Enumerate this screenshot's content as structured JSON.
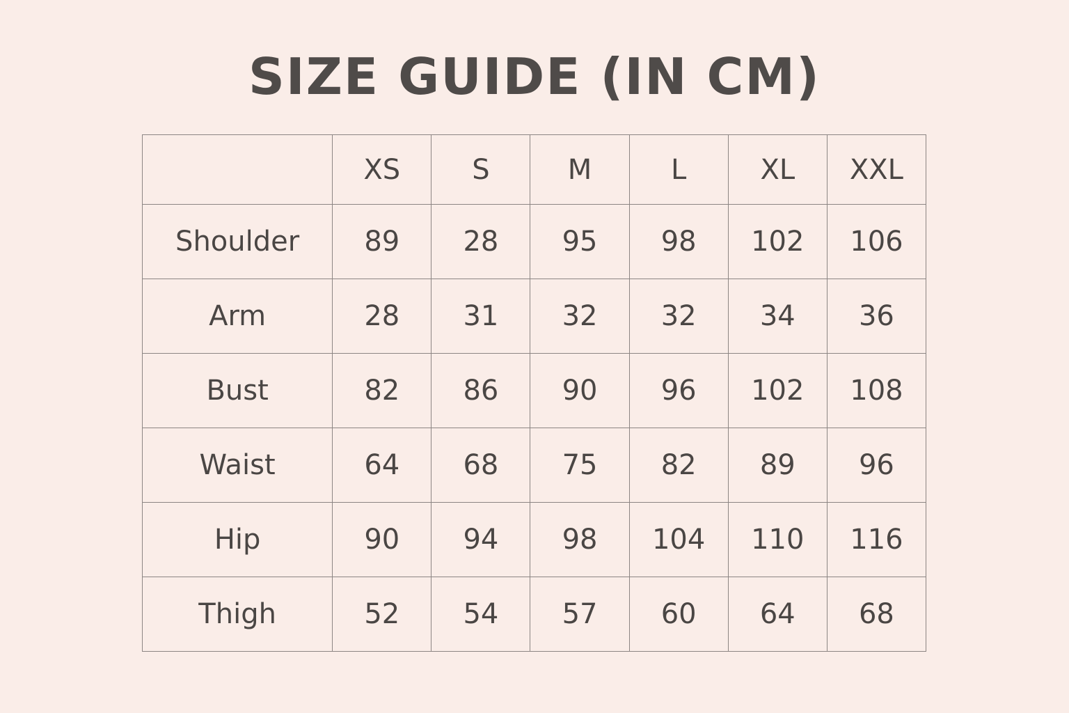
{
  "title": "SIZE GUIDE (IN CM)",
  "table": {
    "corner": "",
    "sizes": [
      "XS",
      "S",
      "M",
      "L",
      "XL",
      "XXL"
    ],
    "rows": [
      {
        "label": "Shoulder",
        "values": [
          "89",
          "28",
          "95",
          "98",
          "102",
          "106"
        ]
      },
      {
        "label": "Arm",
        "values": [
          "28",
          "31",
          "32",
          "32",
          "34",
          "36"
        ]
      },
      {
        "label": "Bust",
        "values": [
          "82",
          "86",
          "90",
          "96",
          "102",
          "108"
        ]
      },
      {
        "label": "Waist",
        "values": [
          "64",
          "68",
          "75",
          "82",
          "89",
          "96"
        ]
      },
      {
        "label": "Hip",
        "values": [
          "90",
          "94",
          "98",
          "104",
          "110",
          "116"
        ]
      },
      {
        "label": "Thigh",
        "values": [
          "52",
          "54",
          "57",
          "60",
          "64",
          "68"
        ]
      }
    ]
  },
  "colors": {
    "background": "#faede8",
    "text": "#4a4644",
    "grid": "#8c8583"
  }
}
